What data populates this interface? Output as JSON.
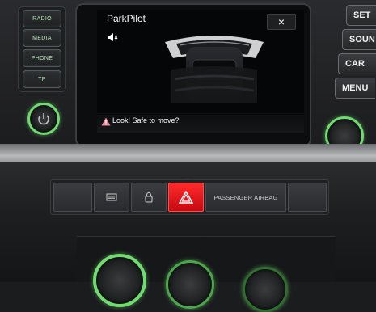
{
  "left_keys": [
    "RADIO",
    "MEDIA",
    "PHONE",
    "TP"
  ],
  "right_keys": [
    "SET",
    "SOUN",
    "CAR",
    "MENU"
  ],
  "screen": {
    "title": "ParkPilot",
    "close_label": "×",
    "icons": [
      "sound-icon",
      "warning-icon"
    ],
    "warning": "Look! Safe to move?"
  },
  "console": {
    "airbag_label": "PASSENGER AIRBAG",
    "icons": [
      "rear-defrost-icon",
      "lock-icon",
      "hazard-icon"
    ]
  },
  "colors": {
    "knob_ring": "#6edc6e",
    "hazard": "#e0141c",
    "warning": "#f08a9a"
  }
}
